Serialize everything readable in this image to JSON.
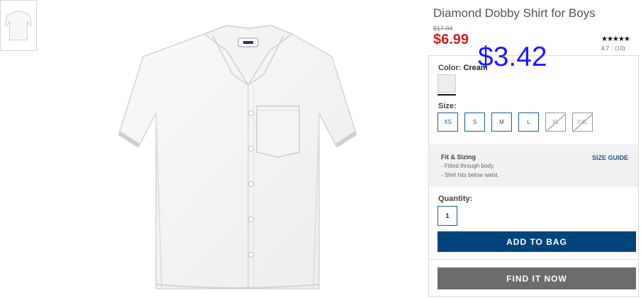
{
  "product": {
    "title": "Diamond Dobby Shirt for Boys",
    "original_price": "$17.94",
    "sale_price": "$6.99",
    "overlay_price": "$3.42",
    "rating_stars": "★★★★★",
    "rating_value": "4.7",
    "rating_count": "(10)"
  },
  "color": {
    "label": "Color:",
    "selected": "Cream",
    "swatch_hex": "#ededed"
  },
  "size": {
    "label": "Size:",
    "options": [
      {
        "label": "XS",
        "available": true
      },
      {
        "label": "S",
        "available": true
      },
      {
        "label": "M",
        "available": true
      },
      {
        "label": "L",
        "available": true
      },
      {
        "label": "XL",
        "available": false
      },
      {
        "label": "XXL",
        "available": false
      }
    ]
  },
  "fit": {
    "title": "Fit & Sizing",
    "lines": [
      "- Fitted through body.",
      "- Shirt hits below waist."
    ],
    "size_guide_label": "SIZE GUIDE"
  },
  "quantity": {
    "label": "Quantity:",
    "value": "1"
  },
  "actions": {
    "add_to_bag": "ADD TO BAG",
    "find_it_now": "FIND IT NOW"
  },
  "colors": {
    "sale_red": "#cc1f1f",
    "overlay_blue": "#1a1aff",
    "primary_navy": "#00447c",
    "secondary_gray": "#6c6c6c"
  },
  "images": {
    "thumbnail": "shirt-thumbnail",
    "main": "white-short-sleeve-shirt"
  }
}
